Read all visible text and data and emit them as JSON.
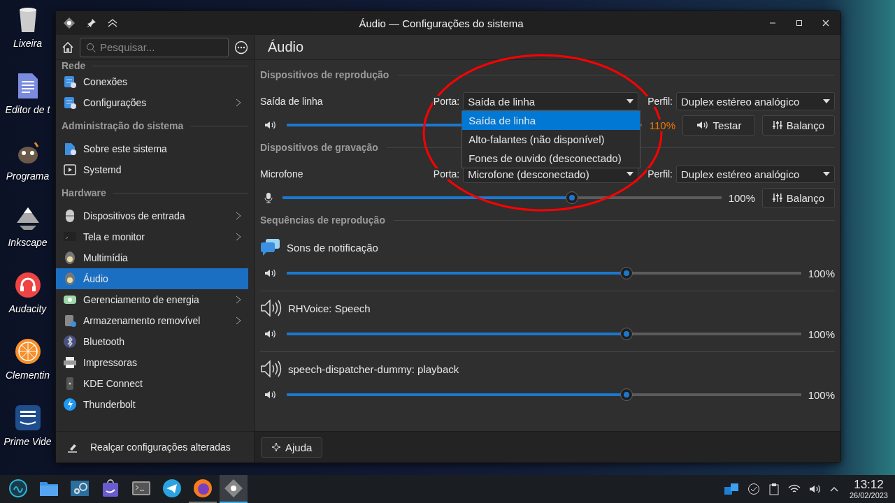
{
  "desktop_icons": [
    {
      "label": "Lixeira",
      "kind": "trash"
    },
    {
      "label": "Editor de t",
      "kind": "document"
    },
    {
      "label": "Programa",
      "kind": "gimp"
    },
    {
      "label": "Inkscape",
      "kind": "inkscape"
    },
    {
      "label": "Audacity",
      "kind": "headphones"
    },
    {
      "label": "Clementin",
      "kind": "orange"
    },
    {
      "label": "Prime Vide",
      "kind": "video"
    }
  ],
  "window": {
    "title": "Áudio — Configurações do sistema"
  },
  "sidebar": {
    "search": {
      "placeholder": "Pesquisar..."
    },
    "groups": [
      {
        "title": "Rede",
        "items": [
          {
            "label": "Conexões",
            "kind": "network",
            "expandable": false,
            "selected": false
          },
          {
            "label": "Configurações",
            "kind": "network",
            "expandable": true,
            "selected": false
          }
        ]
      },
      {
        "title": "Administração do sistema",
        "items": [
          {
            "label": "Sobre este sistema",
            "kind": "info",
            "expandable": false,
            "selected": false
          },
          {
            "label": "Systemd",
            "kind": "play",
            "expandable": false,
            "selected": false
          }
        ]
      },
      {
        "title": "Hardware",
        "items": [
          {
            "label": "Dispositivos de entrada",
            "kind": "mouse",
            "expandable": true,
            "selected": false
          },
          {
            "label": "Tela e monitor",
            "kind": "monitor",
            "expandable": true,
            "selected": false
          },
          {
            "label": "Multimídia",
            "kind": "speaker",
            "expandable": false,
            "selected": false
          },
          {
            "label": "Áudio",
            "kind": "speaker",
            "expandable": false,
            "selected": true
          },
          {
            "label": "Gerenciamento de energia",
            "kind": "battery",
            "expandable": true,
            "selected": false
          },
          {
            "label": "Armazenamento removível",
            "kind": "drive",
            "expandable": true,
            "selected": false
          },
          {
            "label": "Bluetooth",
            "kind": "bluetooth",
            "expandable": false,
            "selected": false
          },
          {
            "label": "Impressoras",
            "kind": "printer",
            "expandable": false,
            "selected": false
          },
          {
            "label": "KDE Connect",
            "kind": "phone",
            "expandable": false,
            "selected": false
          },
          {
            "label": "Thunderbolt",
            "kind": "lightning",
            "expandable": false,
            "selected": false
          }
        ]
      }
    ],
    "footer": "Realçar configurações alteradas"
  },
  "page_title": "Áudio",
  "sections": [
    {
      "title": "Dispositivos de reprodução",
      "devices": [
        {
          "name": "Saída de linha",
          "kind": "output",
          "port_label": "Porta:",
          "port": "Saída de linha",
          "profile_label": "Perfil:",
          "profile": "Duplex estéreo analógico",
          "level": 0.73,
          "reading": "110%",
          "warning": true,
          "buttons": [
            {
              "label": "Testar",
              "kind": "test"
            },
            {
              "label": "Balanço",
              "kind": "balance"
            }
          ],
          "port_menu": [
            {
              "label": "Saída de linha",
              "selected": true
            },
            {
              "label": "Alto-falantes (não disponível)",
              "selected": false
            },
            {
              "label": "Fones de ouvido (desconectado)",
              "selected": false
            }
          ]
        }
      ]
    },
    {
      "title": "Dispositivos de gravação",
      "devices": [
        {
          "name": "Microfone",
          "kind": "input",
          "port_label": "Porta:",
          "port": "Microfone (desconectado)",
          "profile_label": "Perfil:",
          "profile": "Duplex estéreo analógico",
          "level": 0.66,
          "reading": "100%",
          "warning": false,
          "buttons": [
            {
              "label": "Balanço",
              "kind": "balance"
            }
          ]
        }
      ]
    }
  ],
  "streams": {
    "title": "Sequências de reprodução",
    "items": [
      {
        "name": "Sons de notificação",
        "kind": "notification",
        "level": 0.66,
        "reading": "100%"
      },
      {
        "name": "RHVoice: Speech",
        "kind": "speaker",
        "level": 0.66,
        "reading": "100%"
      },
      {
        "name": "speech-dispatcher-dummy: playback",
        "kind": "speaker",
        "level": 0.66,
        "reading": "100%"
      }
    ]
  },
  "help_button": "Ajuda",
  "taskbar": {
    "launchers": [
      {
        "kind": "logo",
        "running": false,
        "selected": false
      },
      {
        "kind": "folder",
        "running": false,
        "selected": false
      },
      {
        "kind": "gears",
        "running": false,
        "selected": false
      },
      {
        "kind": "bag",
        "running": false,
        "selected": false
      },
      {
        "kind": "terminal",
        "running": false,
        "selected": false
      },
      {
        "kind": "plane",
        "running": false,
        "selected": false
      },
      {
        "kind": "globe",
        "running": true,
        "selected": false
      },
      {
        "kind": "settings",
        "running": true,
        "selected": true
      }
    ],
    "clock": "13:12",
    "date": "26/02/2023"
  }
}
